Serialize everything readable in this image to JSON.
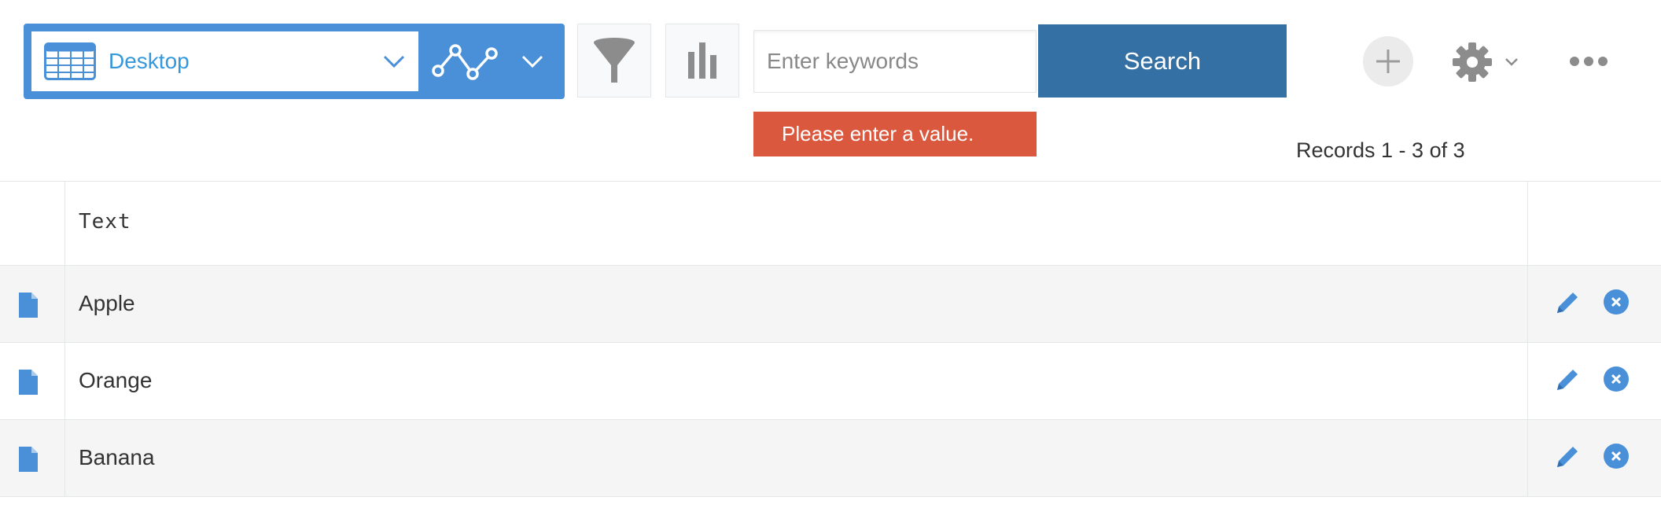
{
  "toolbar": {
    "view_label": "Desktop",
    "search_placeholder": "Enter keywords",
    "search_value": "",
    "search_button": "Search",
    "error_message": "Please enter a value.",
    "icons": {
      "view": "table-grid-icon",
      "view_dropdown": "chevron-down-icon",
      "graph": "line-graph-icon",
      "graph_dropdown": "chevron-down-icon",
      "filter": "filter-funnel-icon",
      "chart": "bar-chart-icon",
      "add": "plus-icon",
      "settings": "gear-icon",
      "more": "more-dots-icon"
    }
  },
  "records_label": "Records 1 - 3 of 3",
  "table": {
    "columns": [
      "Text"
    ],
    "rows": [
      {
        "text": "Apple"
      },
      {
        "text": "Orange"
      },
      {
        "text": "Banana"
      }
    ]
  },
  "colors": {
    "accent": "#4a90d9",
    "search_button": "#3470a3",
    "error": "#d9583e",
    "icon_blue": "#4a90d9",
    "gray_icon": "#8c8c8c"
  }
}
